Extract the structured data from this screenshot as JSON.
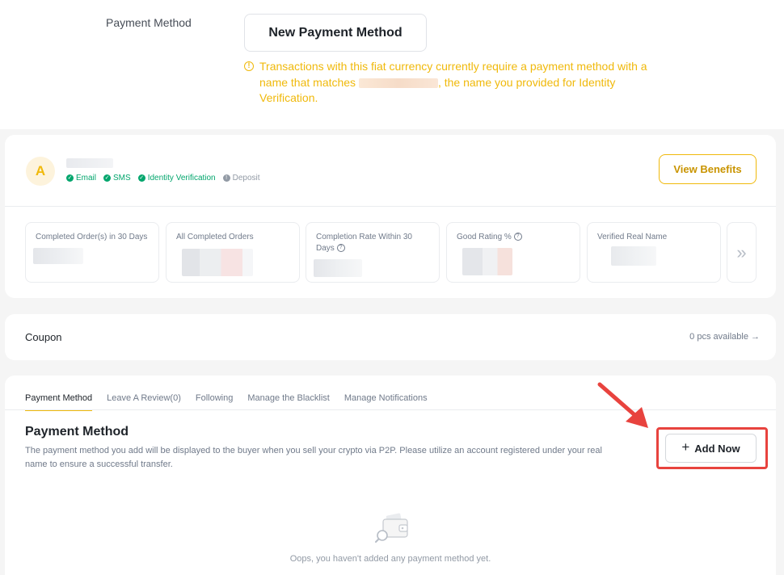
{
  "top": {
    "label": "Payment Method",
    "new_payment_button": "New Payment Method",
    "warning_prefix": "Transactions with this fiat currency currently require a payment method with a name that matches",
    "warning_suffix": ", the name you provided for Identity Verification.",
    "colors": {
      "warning": "#f0b90b"
    }
  },
  "profile": {
    "avatar_letter": "A",
    "badges": [
      {
        "label": "Email",
        "icon": "check-circle-icon"
      },
      {
        "label": "SMS",
        "icon": "check-circle-icon"
      },
      {
        "label": "Identity Verification",
        "icon": "check-circle-icon"
      },
      {
        "label": "Deposit",
        "icon": "info-circle-icon"
      }
    ],
    "view_benefits": "View Benefits",
    "stats": [
      {
        "label": "Completed Order(s) in 30 Days"
      },
      {
        "label": "All Completed Orders"
      },
      {
        "label": "Completion Rate Within 30 Days"
      },
      {
        "label": "Good Rating %"
      },
      {
        "label": "Verified Real Name"
      }
    ],
    "more_icon": "double-chevron-right-icon"
  },
  "coupon": {
    "label": "Coupon",
    "available": "0 pcs available →"
  },
  "main": {
    "tabs": [
      {
        "label": "Payment Method",
        "active": true
      },
      {
        "label": "Leave A Review(0)",
        "active": false
      },
      {
        "label": "Following",
        "active": false
      },
      {
        "label": "Manage the Blacklist",
        "active": false
      },
      {
        "label": "Manage Notifications",
        "active": false
      }
    ],
    "title": "Payment Method",
    "description": "The payment method you add will be displayed to the buyer when you sell your crypto via P2P. Please utilize an account registered under your real name to ensure a successful transfer.",
    "add_now": "Add Now",
    "empty_text": "Oops, you haven't added any payment method yet.",
    "colors": {
      "accent": "#f0b90b",
      "highlight": "#e8433e"
    }
  }
}
